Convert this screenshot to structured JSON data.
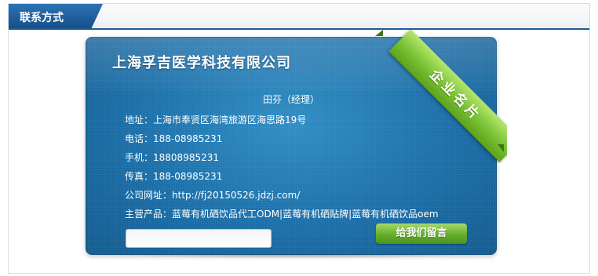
{
  "panel": {
    "title": "联系方式"
  },
  "card": {
    "company": "上海孚吉医学科技有限公司",
    "ribbon_label": "企业名片",
    "contact_person": "田芬（经理）",
    "rows": [
      {
        "label": "地址：",
        "value": "上海市奉贤区海湾旅游区海思路19号"
      },
      {
        "label": "电话：",
        "value": "188-08985231"
      },
      {
        "label": "手机：",
        "value": "18808985231"
      },
      {
        "label": "传真：",
        "value": "188-08985231"
      },
      {
        "label": "公司网址：",
        "value": "http://fj20150526.jdzj.com/"
      },
      {
        "label": "主营产品：",
        "value": "蓝莓有机硒饮品代工ODM|蓝莓有机硒贴牌|蓝莓有机硒饮品oem"
      }
    ],
    "message_input": {
      "value": ""
    },
    "message_button": "给我们留言"
  },
  "colors": {
    "header_accent": "#1c5d95",
    "card_blue": "#1a6ea8",
    "ribbon_green": "#7cc436"
  }
}
